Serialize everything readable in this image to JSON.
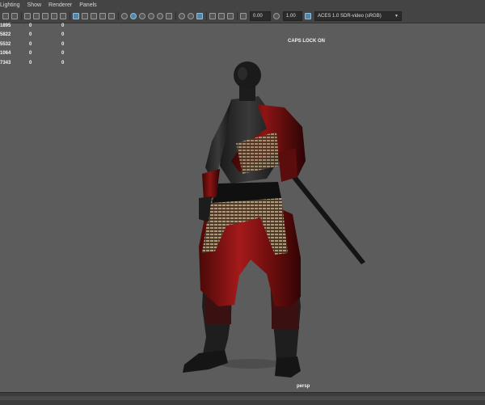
{
  "menu": [
    "Lighting",
    "Show",
    "Renderer",
    "Panels"
  ],
  "toolbar": {
    "icons": [
      "camera-icon",
      "bookmark-icon",
      "select-camera-icon",
      "grid-icon",
      "film-gate-icon",
      "resolution-gate-icon",
      "safe-action-icon",
      "isolate-icon",
      "wireframe-icon",
      "smooth-shade-icon",
      "default-material-icon",
      "textured-icon",
      "lights-icon",
      "shadows-icon",
      "ambient-occlusion-icon",
      "motion-blur-icon",
      "antialias-icon",
      "xray-icon",
      "xray-joints-icon",
      "backface-icon",
      "isolate-select-icon",
      "frame-all-icon",
      "exposure-icon",
      "gamma-icon"
    ],
    "exposure_value": "0.00",
    "gamma_value": "1.00",
    "color_space": "ACES 1.0 SDR-video (sRGB)"
  },
  "hud": {
    "rows": [
      {
        "value": "1895",
        "a": "0",
        "b": "0"
      },
      {
        "value": "5822",
        "a": "0",
        "b": "0"
      },
      {
        "value": "5532",
        "a": "0",
        "b": "0"
      },
      {
        "value": "1064",
        "a": "0",
        "b": "0"
      },
      {
        "value": "7343",
        "a": "0",
        "b": "0"
      }
    ]
  },
  "viewport": {
    "caps_lock": "CAPS LOCK ON",
    "camera": "persp"
  }
}
